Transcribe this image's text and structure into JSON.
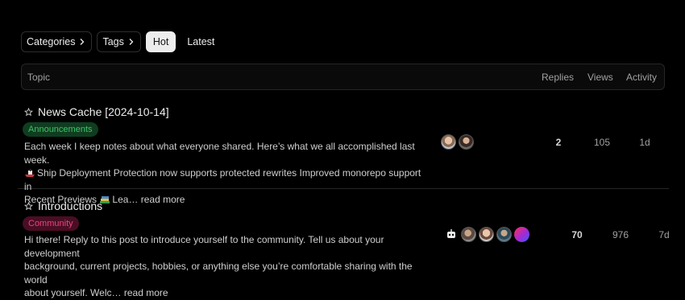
{
  "nav": {
    "categories": "Categories",
    "tags": "Tags",
    "hot": "Hot",
    "latest": "Latest"
  },
  "table_header": {
    "topic": "Topic",
    "replies": "Replies",
    "views": "Views",
    "activity": "Activity"
  },
  "topics": [
    {
      "title": "News Cache [2024-10-14]",
      "category": "Announcements",
      "excerpt_line1": "Each week I keep notes about what everyone shared. Here’s what we all accomplished last week.",
      "excerpt_line2": "Ship Deployment Protection now supports protected rewrites Improved monorepo support in",
      "excerpt_line3": "Recent Previews",
      "excerpt_line3_tail": "Lea…",
      "read_more": "read more",
      "replies": "2",
      "views": "105",
      "activity": "1d"
    },
    {
      "title": "Introductions",
      "category": "Community",
      "excerpt_line1": "Hi there! Reply to this post to introduce yourself to the community. Tell us about your development",
      "excerpt_line2": "background, current projects, hobbies, or anything else you’re comfortable sharing with the world",
      "excerpt_line3": "about yourself. Welc…",
      "read_more": "read more",
      "replies": "70",
      "views": "976",
      "activity": "7d"
    }
  ],
  "colors": {
    "background": "#000000",
    "announcements_badge": "#3ec26a",
    "community_badge": "#e6457a"
  }
}
